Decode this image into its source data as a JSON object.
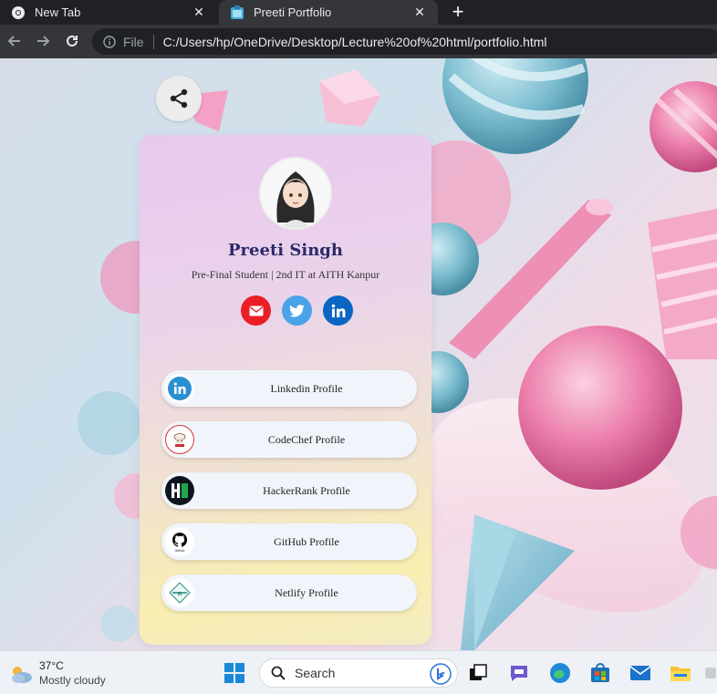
{
  "browser": {
    "tabs": [
      {
        "title": "New Tab"
      },
      {
        "title": "Preeti Portfolio"
      }
    ],
    "address": {
      "scheme_label": "File",
      "url": "C:/Users/hp/OneDrive/Desktop/Lecture%20of%20html/portfolio.html"
    }
  },
  "profile": {
    "name": "Preeti Singh",
    "subtitle": "Pre-Final Student | 2nd IT at AITH Kanpur"
  },
  "social_icons": [
    "mail-icon",
    "twitter-icon",
    "linkedin-icon"
  ],
  "links": [
    {
      "label": "Linkedin Profile",
      "icon": "linkedin-icon"
    },
    {
      "label": "CodeChef Profile",
      "icon": "codechef-icon"
    },
    {
      "label": "HackerRank Profile",
      "icon": "hackerrank-icon"
    },
    {
      "label": "GitHub Profile",
      "icon": "github-icon"
    },
    {
      "label": "Netlify Profile",
      "icon": "netlify-icon"
    }
  ],
  "taskbar": {
    "weather": {
      "temp": "37°C",
      "condition": "Mostly cloudy"
    },
    "search_placeholder": "Search"
  },
  "colors": {
    "accent_name": "#2a2a6a",
    "mail": "#ea1f25",
    "twitter": "#4aa3e8",
    "linkedin": "#0a66c2"
  }
}
